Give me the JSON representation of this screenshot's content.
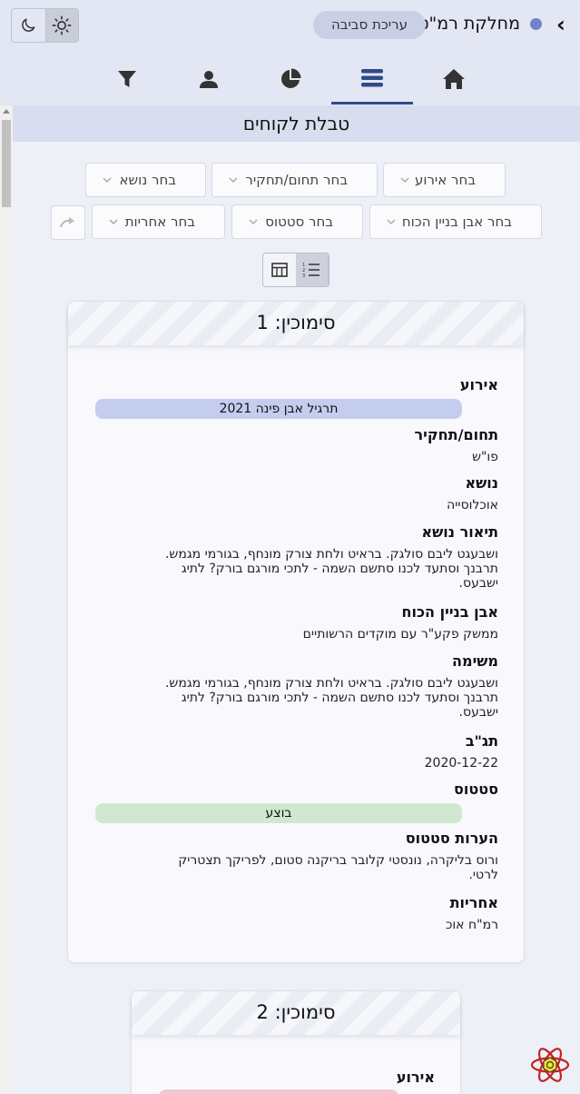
{
  "header": {
    "department": "מחלקת רמ\"ט",
    "env_button": "עריכת סביבה",
    "accent_dot_color": "#6f86c6"
  },
  "tabs": [
    {
      "icon": "home-icon",
      "active": false
    },
    {
      "icon": "list-icon",
      "active": true
    },
    {
      "icon": "pie-chart-icon",
      "active": false
    },
    {
      "icon": "user-icon",
      "active": false
    },
    {
      "icon": "filter-icon",
      "active": false
    }
  ],
  "page": {
    "title": "טבלת לקוחים"
  },
  "filters": {
    "event": "בחר אירוע",
    "domain": "בחר תחום/תחקיר",
    "topic": "בחר נושא",
    "cornerstone": "בחר אבן בניין הכוח",
    "status": "בחר סטטוס",
    "owner": "בחר אחריות"
  },
  "cards": [
    {
      "title": "סימוכין: 1",
      "event_label": "אירוע",
      "event_value": "תרגיל אבן פינה 2021",
      "domain_label": "תחום/תחקיר",
      "domain_value": "פו\"ש",
      "topic_label": "נושא",
      "topic_value": "אוכלוסייה",
      "topic_desc_label": "תיאור נושא",
      "topic_desc_lines": [
        "ושבעגט ליבם סולגק. בראיט ולחת צורק מונחף, בגורמי מגמש.",
        "תרבנך וסתעד לכנו סתשם השמה - לתכי מורגם בורק? לתיג",
        "ישבעס."
      ],
      "cornerstone_label": "אבן בניין הכוח",
      "cornerstone_value": "ממשק פקע\"ר עם מוקדים הרשותיים",
      "task_label": "משימה",
      "task_lines": [
        "ושבעגט ליבם סולגק. בראיט ולחת צורק מונחף, בגורמי מגמש.",
        "תרבנך וסתעד לכנו סתשם השמה - לתכי מורגם בורק? לתיג",
        "ישבעס."
      ],
      "date_label": "תג\"ב",
      "date_value": "2020-12-22",
      "status_label": "סטטוס",
      "status_value": "בוצע",
      "status_notes_label": "הערות סטטוס",
      "status_notes_lines": [
        "ורוס בליקרה, נונסטי קלובר בריקנה סטום, לפריקך תצטריק",
        "לרטי."
      ],
      "owner_label": "אחריות",
      "owner_value": "רמ\"ח אוכ"
    },
    {
      "title": "סימוכין: 2",
      "event_label": "אירוע"
    }
  ],
  "colors": {
    "event_pill": "#c5cdef",
    "status_pill": "#cfe8cf",
    "event2_pill": "#f0c8d0"
  }
}
